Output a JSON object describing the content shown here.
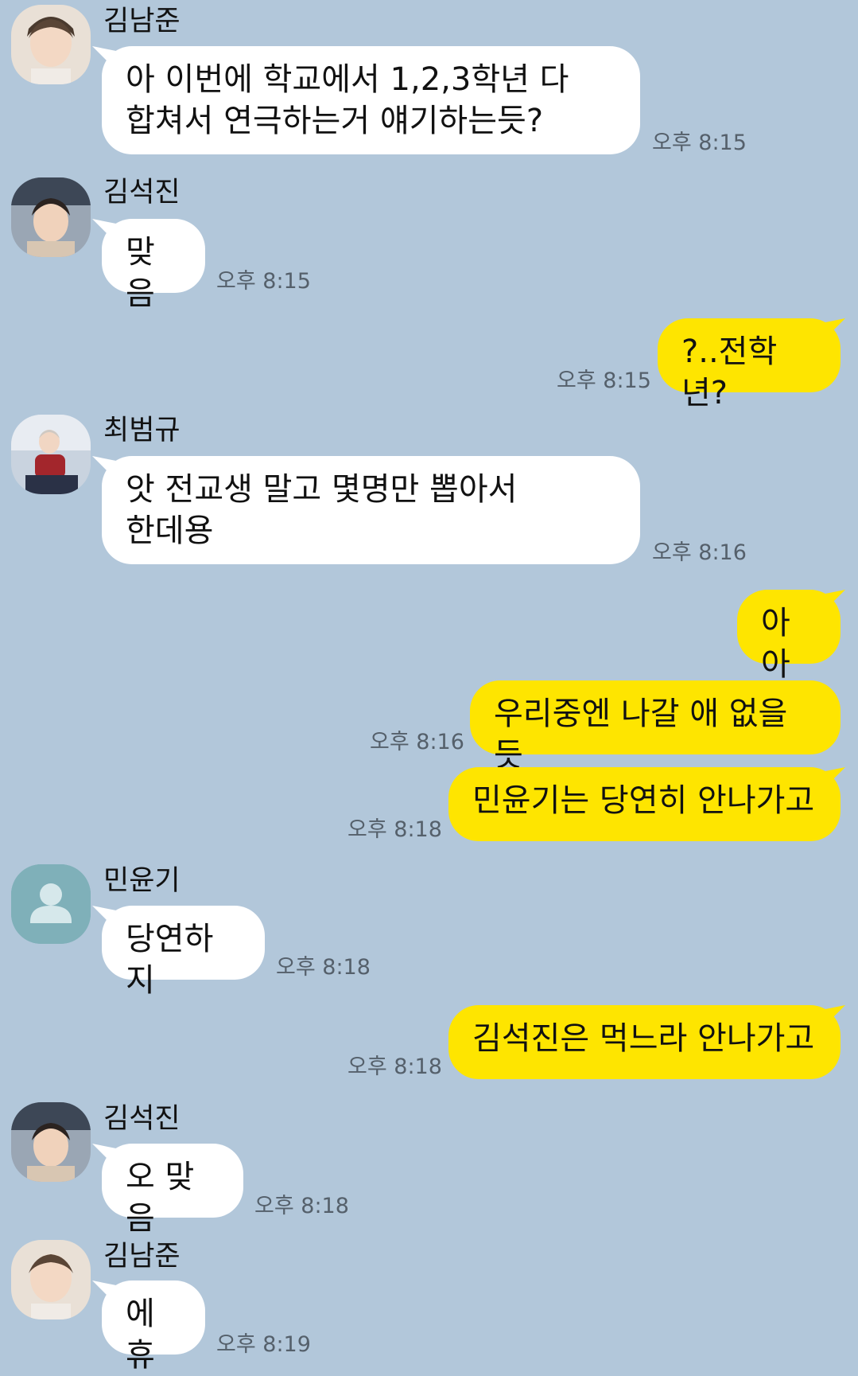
{
  "colors": {
    "background": "#b2c7da",
    "incoming_bubble": "#ffffff",
    "outgoing_bubble": "#fee500",
    "timestamp": "#55606b"
  },
  "messages": [
    {
      "sender": "김남준",
      "text": "아 이번에 학교에서 1,2,3학년 다\n합쳐서 연극하는거 얘기하는듯?",
      "time": "오후 8:15",
      "avatar": "namjoon-avatar"
    },
    {
      "sender": "김석진",
      "text": "맞음",
      "time": "오후 8:15",
      "avatar": "seokjin-avatar"
    },
    {
      "sender": "me",
      "text": "?..전학년?",
      "time": "오후 8:15"
    },
    {
      "sender": "최범규",
      "text": "앗 전교생 말고 몇명만 뽑아서\n한데용",
      "time": "오후 8:16",
      "avatar": "beomgyu-avatar"
    },
    {
      "sender": "me",
      "text": "아아",
      "time": ""
    },
    {
      "sender": "me",
      "text": "우리중엔 나갈 애 없을듯",
      "time": "오후 8:16"
    },
    {
      "sender": "me",
      "text": "민윤기는 당연히 안나가고",
      "time": "오후 8:18"
    },
    {
      "sender": "민윤기",
      "text": "당연하지",
      "time": "오후 8:18",
      "avatar": "default-person-avatar"
    },
    {
      "sender": "me",
      "text": "김석진은 먹느라 안나가고",
      "time": "오후 8:18"
    },
    {
      "sender": "김석진",
      "text": "오 맞음",
      "time": "오후 8:18",
      "avatar": "seokjin-avatar"
    },
    {
      "sender": "김남준",
      "text": "에휴",
      "time": "오후 8:19",
      "avatar": "namjoon-avatar"
    }
  ]
}
